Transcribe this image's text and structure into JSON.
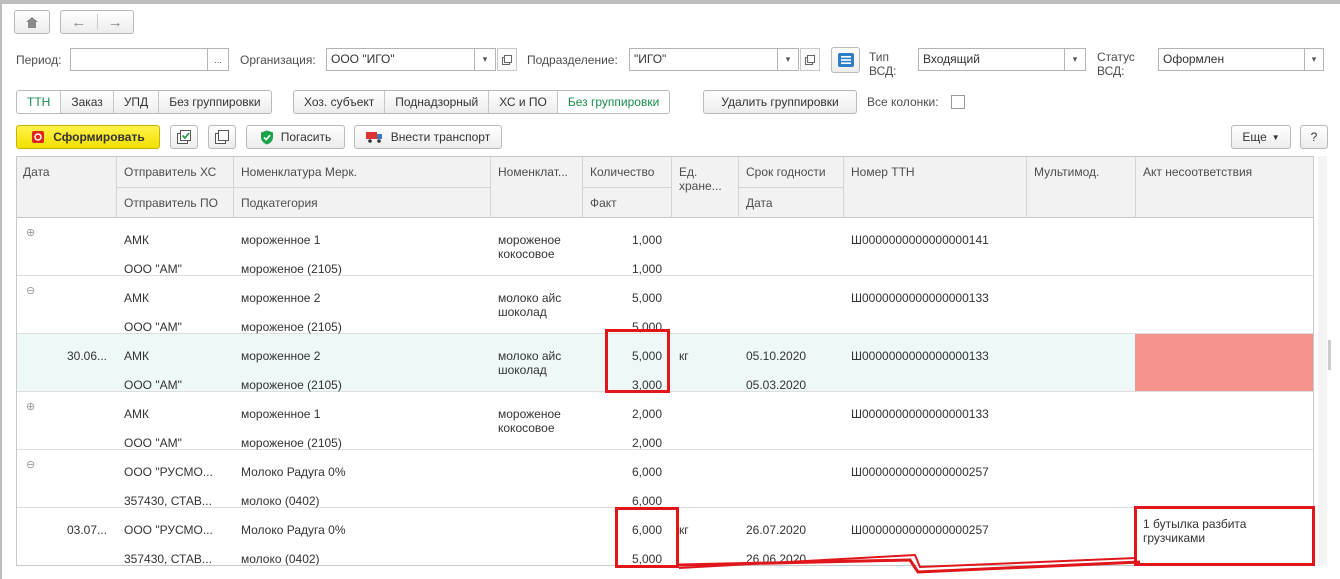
{
  "nav": {
    "home_icon": "home-icon",
    "back_icon": "arrow-left-icon",
    "forward_icon": "arrow-right-icon"
  },
  "filters": {
    "period_label": "Период:",
    "period_value": "",
    "period_btn": "...",
    "org_label": "Организация:",
    "org_value": "ООО \"ИГО\"",
    "dept_label": "Подразделение:",
    "dept_value": "\"ИГО\"",
    "vsd_type_label": "Тип ВСД:",
    "vsd_type_value": "Входящий",
    "vsd_status_label": "Статус ВСД:",
    "vsd_status_value": "Оформлен"
  },
  "grouping1": [
    "ТТН",
    "Заказ",
    "УПД",
    "Без группировки"
  ],
  "grouping2": [
    "Хоз. субъект",
    "Поднадзорный",
    "ХС и ПО",
    "Без группировки"
  ],
  "remove_grouping": "Удалить группировки",
  "all_columns_label": "Все колонки:",
  "toolbar": {
    "generate": "Сформировать",
    "repay": "Погасить",
    "add_transport": "Внести транспорт",
    "more": "Еще",
    "help": "?"
  },
  "columns": {
    "date": "Дата",
    "sender_hs": "Отправитель ХС",
    "sender_po": "Отправитель ПО",
    "nom_merk": "Номенклатура Мерк.",
    "subcategory": "Подкатегория",
    "nomenclature": "Номенклат...",
    "quantity": "Количество",
    "fact": "Факт",
    "unit": "Ед. хране...",
    "expiry": "Срок годности",
    "date2": "Дата",
    "ttn": "Номер ТТН",
    "multimod": "Мультимод.",
    "act": "Акт несоответствия"
  },
  "rows": [
    {
      "expand": "⊕",
      "date": "",
      "hs": "АМК",
      "po": "ООО \"АМ\"",
      "merk": "мороженное 1",
      "sub": "мороженое (2105)",
      "nom": "мороженое кокосовое",
      "qty": "1,000",
      "fact": "1,000",
      "unit": "",
      "exp": "",
      "date2": "",
      "ttn": "Ш0000000000000000141",
      "act": ""
    },
    {
      "expand": "⊖",
      "date": "",
      "hs": "АМК",
      "po": "ООО \"АМ\"",
      "merk": "мороженное 2",
      "sub": "мороженое (2105)",
      "nom": "молоко айс шоколад",
      "qty": "5,000",
      "fact": "5,000",
      "unit": "",
      "exp": "",
      "date2": "",
      "ttn": "Ш0000000000000000133",
      "act": ""
    },
    {
      "expand": "",
      "date": "30.06...",
      "hs": "АМК",
      "po": "ООО \"АМ\"",
      "merk": "мороженное 2",
      "sub": "мороженое (2105)",
      "nom": "молоко айс шоколад",
      "qty": "5,000",
      "fact": "3,000",
      "unit": "кг",
      "exp": "05.10.2020",
      "date2": "05.03.2020",
      "ttn": "Ш0000000000000000133",
      "act": ""
    },
    {
      "expand": "⊕",
      "date": "",
      "hs": "АМК",
      "po": "ООО \"АМ\"",
      "merk": "мороженное 1",
      "sub": "мороженое (2105)",
      "nom": "мороженое кокосовое",
      "qty": "2,000",
      "fact": "2,000",
      "unit": "",
      "exp": "",
      "date2": "",
      "ttn": "Ш0000000000000000133",
      "act": ""
    },
    {
      "expand": "⊖",
      "date": "",
      "hs": "ООО \"РУСМО...",
      "po": "357430, СТАВ...",
      "merk": "Молоко Радуга 0%",
      "sub": "молоко (0402)",
      "nom": "",
      "qty": "6,000",
      "fact": "6,000",
      "unit": "",
      "exp": "",
      "date2": "",
      "ttn": "Ш0000000000000000257",
      "act": ""
    },
    {
      "expand": "",
      "date": "03.07...",
      "hs": "ООО \"РУСМО...",
      "po": "357430, СТАВ...",
      "merk": "Молоко Радуга 0%",
      "sub": "молоко (0402)",
      "nom": "",
      "qty": "6,000",
      "fact": "5,000",
      "unit": "кг",
      "exp": "26.07.2020",
      "date2": "26.06.2020",
      "ttn": "Ш0000000000000000257",
      "act": "1 бутылка разбита грузчиками"
    }
  ],
  "colors": {
    "accent_green": "#178c4c",
    "generate_yellow": "#f7e400",
    "mismatch_red": "#f5948f",
    "annotation_red": "#e0161b"
  }
}
